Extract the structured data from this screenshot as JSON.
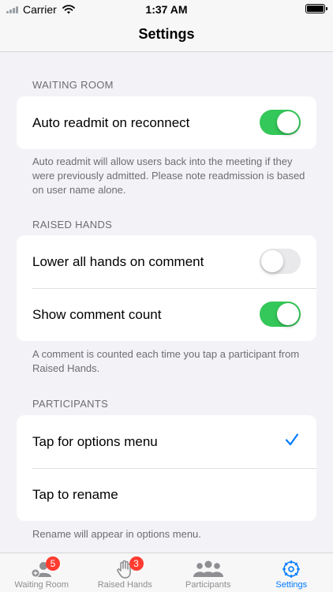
{
  "status_bar": {
    "carrier": "Carrier",
    "time": "1:37 AM"
  },
  "nav": {
    "title": "Settings"
  },
  "waiting_room": {
    "header": "WAITING ROOM",
    "auto_readmit_label": "Auto readmit on reconnect",
    "auto_readmit_on": true,
    "footer": "Auto readmit will allow users back into the meeting if they were previously admitted. Please note readmission is based on user name alone."
  },
  "raised_hands": {
    "header": "RAISED HANDS",
    "lower_hands_label": "Lower all hands on comment",
    "lower_hands_on": false,
    "show_count_label": "Show comment count",
    "show_count_on": true,
    "footer": "A comment is counted each time you tap a participant from Raised Hands."
  },
  "participants": {
    "header": "PARTICIPANTS",
    "options_menu_label": "Tap for options menu",
    "options_menu_checked": true,
    "rename_label": "Tap to rename",
    "footer": "Rename will appear in options menu."
  },
  "tabs": [
    {
      "label": "Waiting Room",
      "icon": "person-add-icon",
      "badge": "5"
    },
    {
      "label": "Raised Hands",
      "icon": "hand-icon",
      "badge": "3"
    },
    {
      "label": "Participants",
      "icon": "group-icon",
      "badge": ""
    },
    {
      "label": "Settings",
      "icon": "gear-icon",
      "badge": "",
      "active": true
    }
  ],
  "colors": {
    "accent": "#007aff",
    "toggle_on": "#34c759",
    "badge": "#ff3b30",
    "background": "#f2f2f7"
  }
}
